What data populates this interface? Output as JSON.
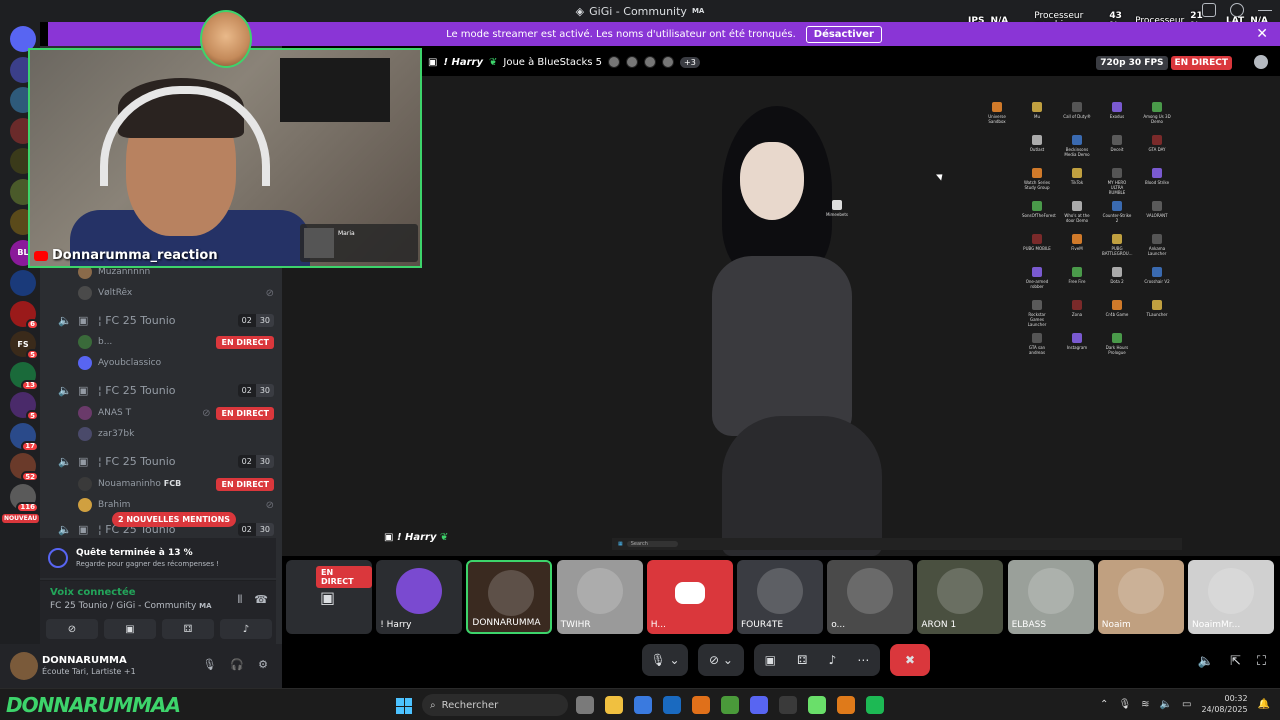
{
  "window": {
    "title": "GiGi - Community",
    "title_tag": "MA"
  },
  "banner": {
    "text": "Le mode streamer est activé. Les noms d'utilisateur ont été tronqués.",
    "button": "Désactiver"
  },
  "perf": {
    "ips_label": "IPS",
    "ips_value": "N/A",
    "gpu_label": "Processeur graphique",
    "gpu_value": "43 %",
    "cpu_label": "Processeur",
    "cpu_value": "21 %",
    "lat_label": "LAT",
    "lat_value": "N/A"
  },
  "servers": [
    {
      "label": "",
      "color": "#5865f2",
      "badge": ""
    },
    {
      "label": "",
      "color": "#3b3f8a",
      "badge": ""
    },
    {
      "label": "",
      "color": "#2e5a7a",
      "badge": ""
    },
    {
      "label": "",
      "color": "#6a2a2a",
      "badge": ""
    },
    {
      "label": "",
      "color": "#3a3a1a",
      "badge": ""
    },
    {
      "label": "",
      "color": "#4a5a2a",
      "badge": ""
    },
    {
      "label": "",
      "color": "#5a4a1a",
      "badge": ""
    },
    {
      "label": "BL",
      "color": "#8a1a9a",
      "badge": ""
    },
    {
      "label": "",
      "color": "#1a3a7a",
      "badge": ""
    },
    {
      "label": "",
      "color": "#9a1a1a",
      "badge": "6"
    },
    {
      "label": "FS",
      "color": "#3a2a1a",
      "badge": "5"
    },
    {
      "label": "",
      "color": "#1a6a3a",
      "badge": "13"
    },
    {
      "label": "",
      "color": "#4a2a6a",
      "badge": "5"
    },
    {
      "label": "",
      "color": "#2a4a8a",
      "badge": "17"
    },
    {
      "label": "",
      "color": "#6a3a2a",
      "badge": "52"
    },
    {
      "label": "",
      "color": "#5a5a5a",
      "badge": "116"
    }
  ],
  "server_new_label": "NOUVEAU",
  "channels": {
    "user_top_1": "Muzannnnn",
    "user_top_2": "VøltRêx",
    "ch1": {
      "name": "¦ FC 25 Tounio",
      "a": "02",
      "b": "30"
    },
    "ch1_user_1": "b...",
    "ch1_user_2": "Ayoubclassico",
    "ch2": {
      "name": "¦ FC 25 Tounio",
      "a": "02",
      "b": "30"
    },
    "ch2_user_1": "ANAS T",
    "ch2_user_2": "zar37bk",
    "ch3": {
      "name": "¦ FC 25 Tounio",
      "a": "02",
      "b": "30"
    },
    "ch3_user_1": "Nouamaninho",
    "ch3_user_1_tag": "FCB",
    "ch3_user_2": "Brahim",
    "ch4": {
      "name": "¦ FC 25 Tounio",
      "a": "02",
      "b": "30"
    },
    "live_label": "EN DIRECT",
    "mentions": "2 NOUVELLES MENTIONS"
  },
  "quest": {
    "title": "Quête terminée à 13 %",
    "subtitle": "Regarde pour gagner des récompenses !"
  },
  "voice": {
    "title": "Voix connectée",
    "subtitle": "FC 25 Tounio / GiGi - Community",
    "subtitle_tag": "MA"
  },
  "user_panel": {
    "name": "DONNARUMMA",
    "status": "Écoute Tari, Lartiste +1"
  },
  "webcam": {
    "label": "Donnarumma_reaction",
    "song": "Maria"
  },
  "stream": {
    "streamer": "! Harry",
    "activity": "Joue à BlueStacks 5",
    "extra_viewers": "+3",
    "quality": "720p 30 FPS",
    "live": "EN DIRECT",
    "streamer_tag": "! Harry"
  },
  "desktop_icons": [
    "Universe Sandbox",
    "Mu",
    "Call of Duty®",
    "Exodus",
    "Among Us 3D Demo",
    "Outlast",
    "Beckinsons Media Demo",
    "Deceit",
    "GTA DAY",
    "Watch Series Study Group",
    "TikTok",
    "MY HERO ULTRA RUMBLE",
    "Blood Strike",
    "SonsOfTheForest",
    "Who's at the door Demo",
    "Counter-Strike 2",
    "VALORANT",
    "PUBG MOBILE",
    "FiveM",
    "PUBG BATTLEGROU...",
    "Ankama Launcher",
    "One-armed robber",
    "Free Fire",
    "Dota 2",
    "Crosshair V2",
    "Rockstar Games Launcher",
    "Zona",
    "Cr4b Game",
    "TLauncher",
    "GTA san andreas",
    "Instagram",
    "Dark Hours Prologue"
  ],
  "desktop_folder": "Mimeebets",
  "desktop_search": "Search",
  "tiles": [
    {
      "label": "",
      "live": "EN DIRECT",
      "color": "#2b2d31"
    },
    {
      "label": "! Harry",
      "live": "",
      "color": "#2b2d31"
    },
    {
      "label": "DONNARUMMA",
      "live": "",
      "color": "#3a2a20"
    },
    {
      "label": "TWIHR",
      "live": "",
      "color": "#9a9a9a"
    },
    {
      "label": "H...",
      "live": "",
      "color": "#da373c"
    },
    {
      "label": "FOUR4TE",
      "live": "",
      "color": "#3a3c42"
    },
    {
      "label": "o...",
      "live": "",
      "color": "#4a4a4a"
    },
    {
      "label": "ARON 1",
      "live": "",
      "color": "#4a5040"
    },
    {
      "label": "ELBASS",
      "live": "",
      "color": "#9aa09a"
    },
    {
      "label": "Noaim",
      "live": "",
      "color": "#c0a080"
    },
    {
      "label": "NoaimMr...",
      "live": "",
      "color": "#d0d0d0"
    }
  ],
  "taskbar": {
    "logo": "DONNARUMMAA",
    "search": "Rechercher",
    "time": "00:32",
    "date": "24/08/2025",
    "app_colors": [
      "#7a7a7a",
      "#f0c040",
      "#3a7adf",
      "#1a6ac0",
      "#e0701a",
      "#4a9a3a",
      "#5865f2",
      "#3a3a3a",
      "#6adf6a",
      "#df7a1a",
      "#1db954"
    ]
  },
  "colors": {
    "accent": "#5865f2",
    "live": "#da373c",
    "banner": "#8a35d6",
    "connected": "#23a55a"
  }
}
